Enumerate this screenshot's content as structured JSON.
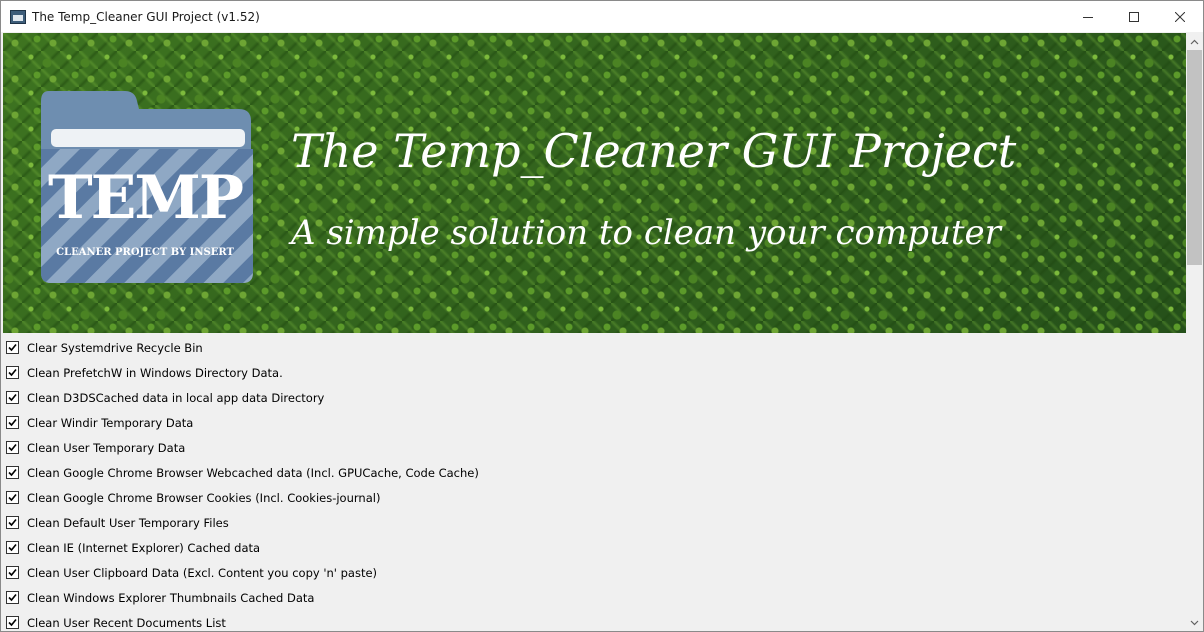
{
  "window": {
    "title": "The Temp_Cleaner GUI Project (v1.52)",
    "icon": "app-icon",
    "controls": [
      "minimize-icon",
      "maximize-icon",
      "close-icon"
    ]
  },
  "banner": {
    "title": "The Temp_Cleaner GUI Project",
    "subtitle": "A simple solution to clean your computer",
    "logo": {
      "main_text": "TEMP",
      "sub_text": "CLEANER PROJECT BY INSERT"
    }
  },
  "options": [
    {
      "label": "Clear Systemdrive Recycle Bin",
      "checked": true
    },
    {
      "label": "Clean PrefetchW in Windows Directory Data.",
      "checked": true
    },
    {
      "label": "Clean D3DSCached data in local app data Directory",
      "checked": true
    },
    {
      "label": "Clear Windir Temporary Data",
      "checked": true
    },
    {
      "label": "Clean User Temporary Data",
      "checked": true
    },
    {
      "label": "Clean Google Chrome Browser Webcached data (Incl. GPUCache, Code Cache)",
      "checked": true
    },
    {
      "label": "Clean Google Chrome Browser Cookies (Incl. Cookies-journal)",
      "checked": true
    },
    {
      "label": "Clean Default User Temporary Files",
      "checked": true
    },
    {
      "label": "Clean IE (Internet Explorer) Cached data",
      "checked": true
    },
    {
      "label": "Clean User Clipboard Data (Excl. Content you copy 'n' paste)",
      "checked": true
    },
    {
      "label": "Clean Windows Explorer Thumbnails Cached Data",
      "checked": true
    },
    {
      "label": "Clean User Recent Documents List",
      "checked": true
    }
  ],
  "colors": {
    "banner_green": "#2d5a19",
    "folder_blue": "#5a7aa3",
    "folder_tab": "#7f9fba"
  }
}
